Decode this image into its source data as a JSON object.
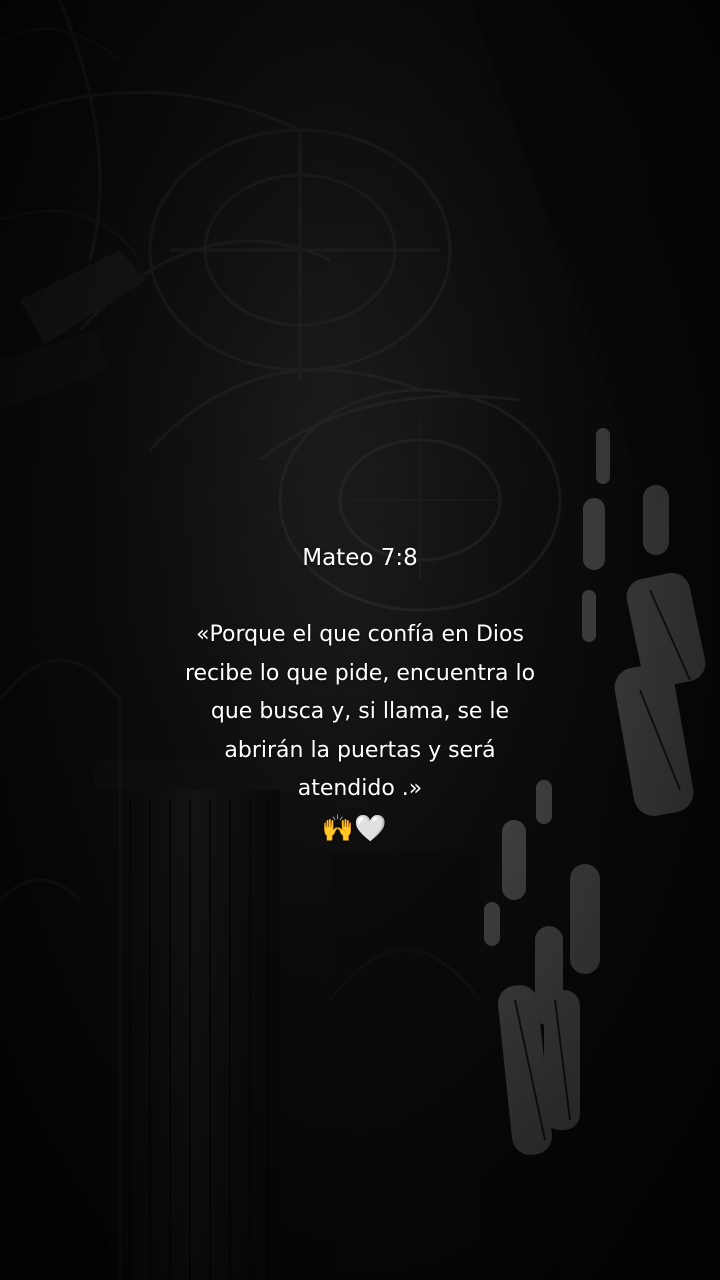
{
  "verse": {
    "reference": "Mateo 7:8",
    "lines": [
      "«Porque el que confía en Dios",
      "recibe lo que pide, encuentra lo",
      "que busca y, si llama, se le",
      "abrirán la puertas y será",
      "atendido .»"
    ],
    "emoji": "🙌🤍"
  }
}
